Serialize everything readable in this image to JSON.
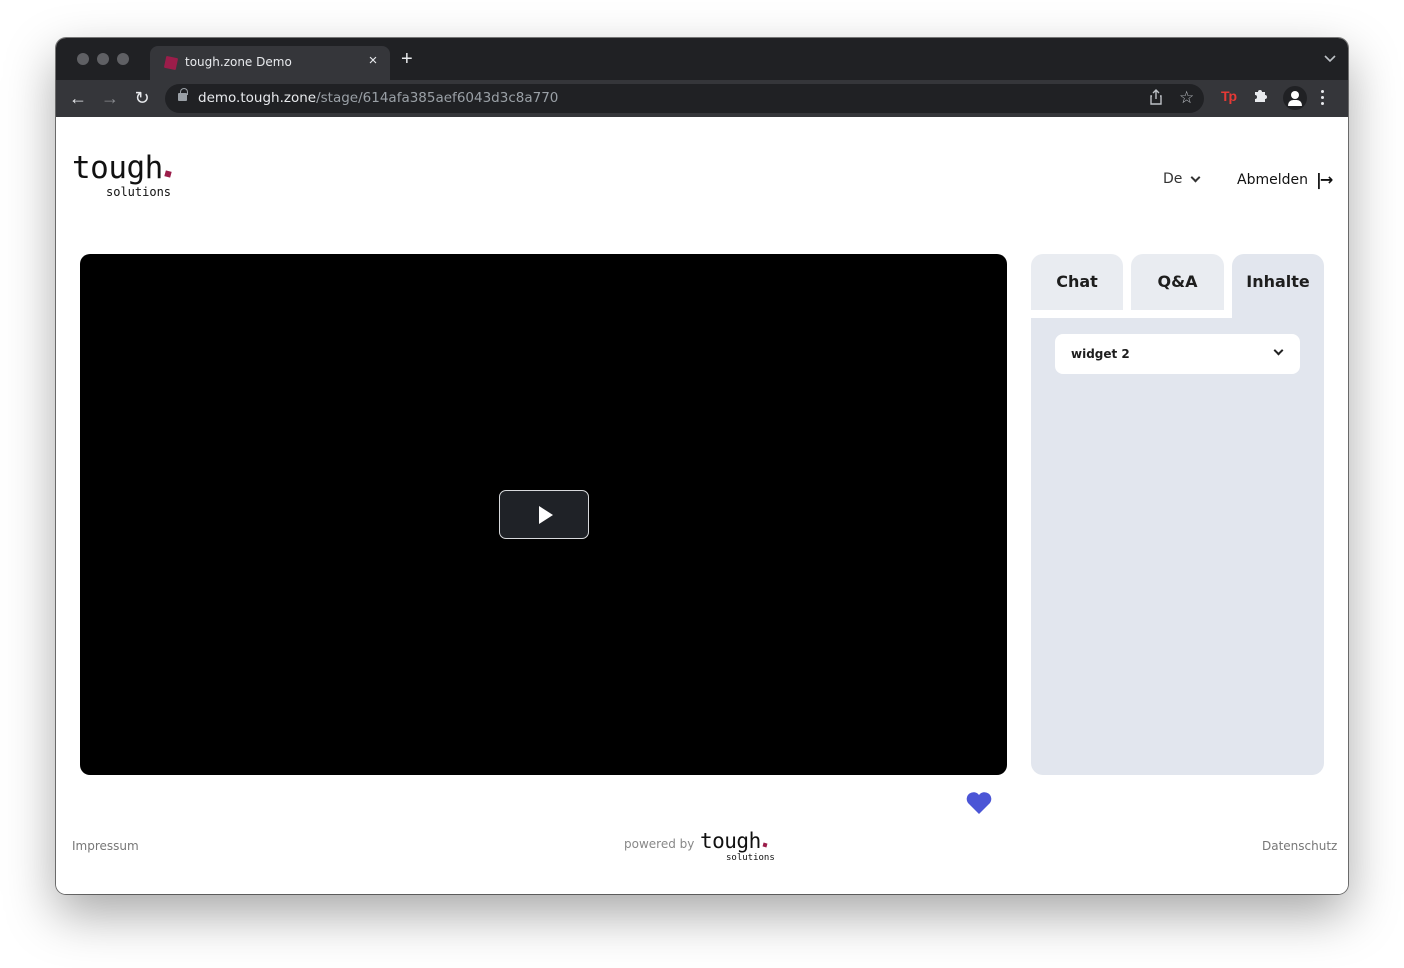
{
  "browser": {
    "tab_title": "tough.zone Demo",
    "close_tab_glyph": "×",
    "new_tab_glyph": "+",
    "url_host": "demo.tough.zone",
    "url_path": "/stage/614afa385aef6043d3c8a770",
    "extension_label": "Tp",
    "icons": {
      "back": "←",
      "forward": "→",
      "reload": "↻",
      "share": "⇪",
      "bookmark": "☆",
      "extensions": "✚",
      "tab_list": "⌄"
    }
  },
  "header": {
    "logo_text": "tough",
    "logo_subtext": "solutions",
    "language": "De",
    "logout_label": "Abmelden",
    "logout_icon": "|→"
  },
  "video": {
    "play_label": "Play"
  },
  "sidebar": {
    "tabs": [
      {
        "label": "Chat",
        "active": false
      },
      {
        "label": "Q&A",
        "active": false
      },
      {
        "label": "Inhalte",
        "active": true
      }
    ],
    "widget_select": {
      "value": "widget 2"
    }
  },
  "footer": {
    "impressum": "Impressum",
    "powered_by": "powered by",
    "logo_text": "tough",
    "logo_subtext": "solutions",
    "datenschutz": "Datenschutz"
  },
  "colors": {
    "brand_dot": "#9b1d4a",
    "heart": "#4b55d6",
    "panel_bg": "#e2e6ee"
  }
}
